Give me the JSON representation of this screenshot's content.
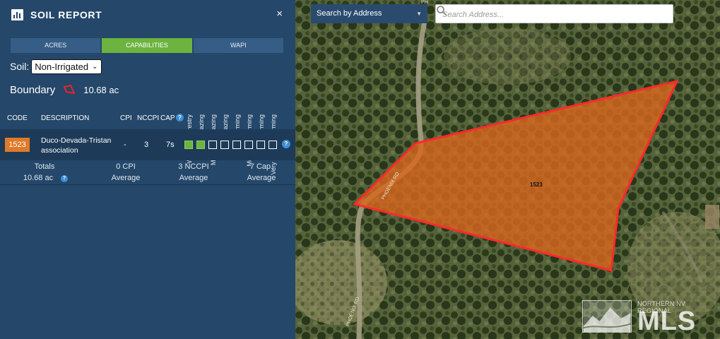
{
  "panel": {
    "title": "SOIL REPORT",
    "close": "×",
    "tabs": [
      "ACRES",
      "CAPABILITIES",
      "WAPI"
    ],
    "soil_label": "Soil:",
    "soil_select": "Non-Irrigated",
    "boundary_label": "Boundary",
    "boundary_value": "10.68 ac",
    "capability_headers": [
      "Wildlife / Forestry",
      "Limited Grazing",
      "Moderate Grazing",
      "Intense Grazing",
      "Limited Farming",
      "Moderate Farming",
      "Intense Farming",
      "Very Intense Farming"
    ],
    "columns": {
      "code": "CODE",
      "description": "DESCRIPTION",
      "cpi": "CPI",
      "nccpi": "NCCPI",
      "cap": "CAP"
    },
    "info_glyph": "?",
    "rows": [
      {
        "code": "1523",
        "description": "Duco-Devada-Tristan association",
        "cpi": "-",
        "nccpi": "3",
        "cap": "7s",
        "boxes": [
          true,
          true,
          false,
          false,
          false,
          false,
          false,
          false
        ]
      }
    ],
    "totals": {
      "label": "Totals",
      "acres": "10.68 ac",
      "cpi": "0 CPI",
      "cpi_sub": "Average",
      "nccpi": "3 NCCPI",
      "nccpi_sub": "Average",
      "cap": "7 Cap.",
      "cap_sub": "Average"
    }
  },
  "map": {
    "search_type": "Search by Address",
    "search_placeholder": "Search Address...",
    "parcel_label": "1523",
    "road_labels": [
      "PHOENIX RD",
      "PHOENIX RD",
      "PH"
    ],
    "logo_small": "NORTHERN NV REGIONAL",
    "logo_big": "MLS"
  },
  "colors": {
    "panel_bg": "#24476a",
    "accent_green": "#6cb33f",
    "badge_orange": "#e07a2a",
    "parcel_fill": "#d7671e",
    "parcel_stroke": "#ff2a2a"
  }
}
